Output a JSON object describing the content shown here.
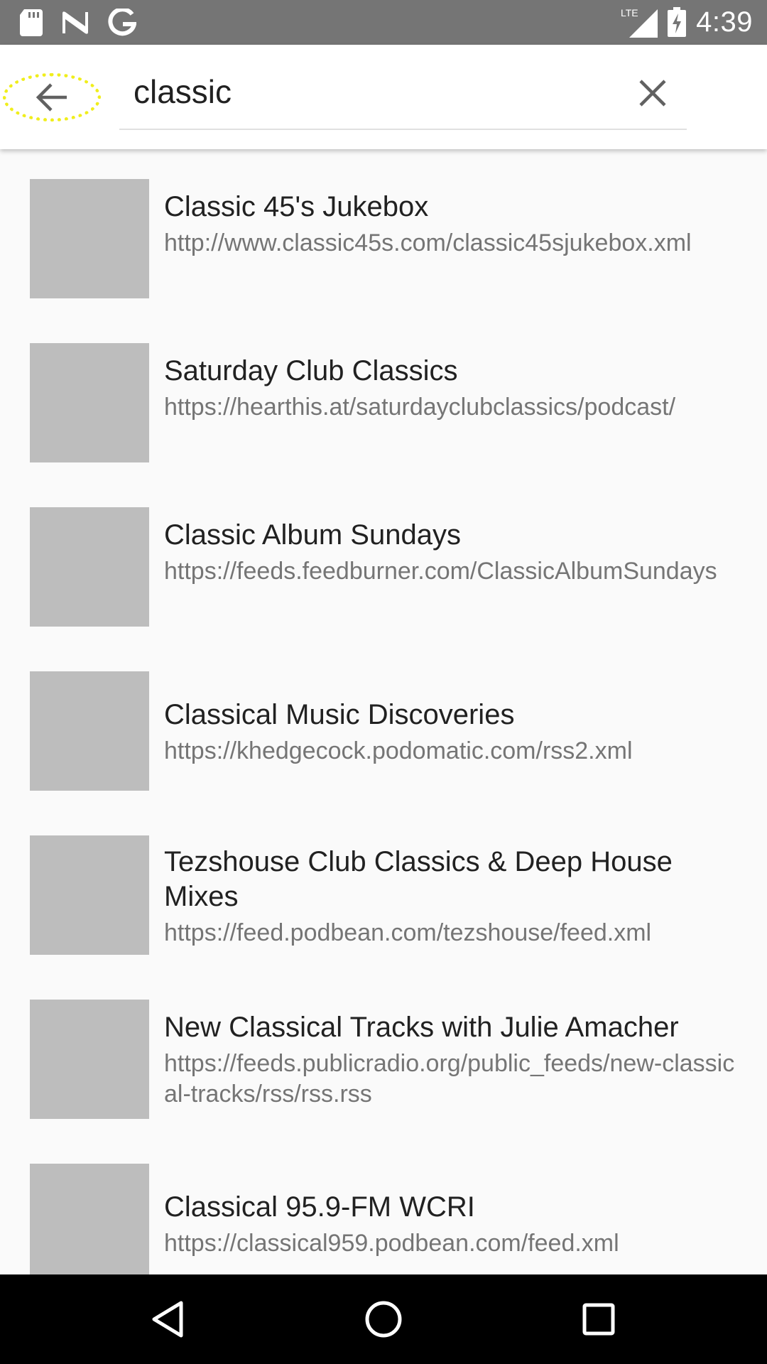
{
  "status_bar": {
    "network": "LTE",
    "time": "4:39"
  },
  "search": {
    "query": "classic",
    "back_icon": "arrow-back-icon",
    "clear_icon": "close-icon"
  },
  "results": [
    {
      "title": "Classic 45's Jukebox",
      "url": "http://www.classic45s.com/classic45sjukebox.xml"
    },
    {
      "title": "Saturday Club Classics",
      "url": "https://hearthis.at/saturdayclubclassics/podcast/"
    },
    {
      "title": "Classic Album Sundays",
      "url": "https://feeds.feedburner.com/ClassicAlbumSundays"
    },
    {
      "title": "Classical Music Discoveries",
      "url": "https://khedgecock.podomatic.com/rss2.xml"
    },
    {
      "title": "Tezshouse Club Classics & Deep House Mixes",
      "url": "https://feed.podbean.com/tezshouse/feed.xml"
    },
    {
      "title": "New Classical Tracks with Julie Amacher",
      "url": "https://feeds.publicradio.org/public_feeds/new-classical-tracks/rss/rss.rss"
    },
    {
      "title": "Classical 95.9-FM WCRI",
      "url": "https://classical959.podbean.com/feed.xml"
    }
  ],
  "colors": {
    "status_bar": "#757575",
    "app_bar": "#ffffff",
    "background": "#fafafa",
    "thumbnail_placeholder": "#bdbdbd",
    "title_text": "#212121",
    "url_text": "#757575",
    "focus_ring": "#f0ee1c",
    "nav_bar": "#000000"
  }
}
